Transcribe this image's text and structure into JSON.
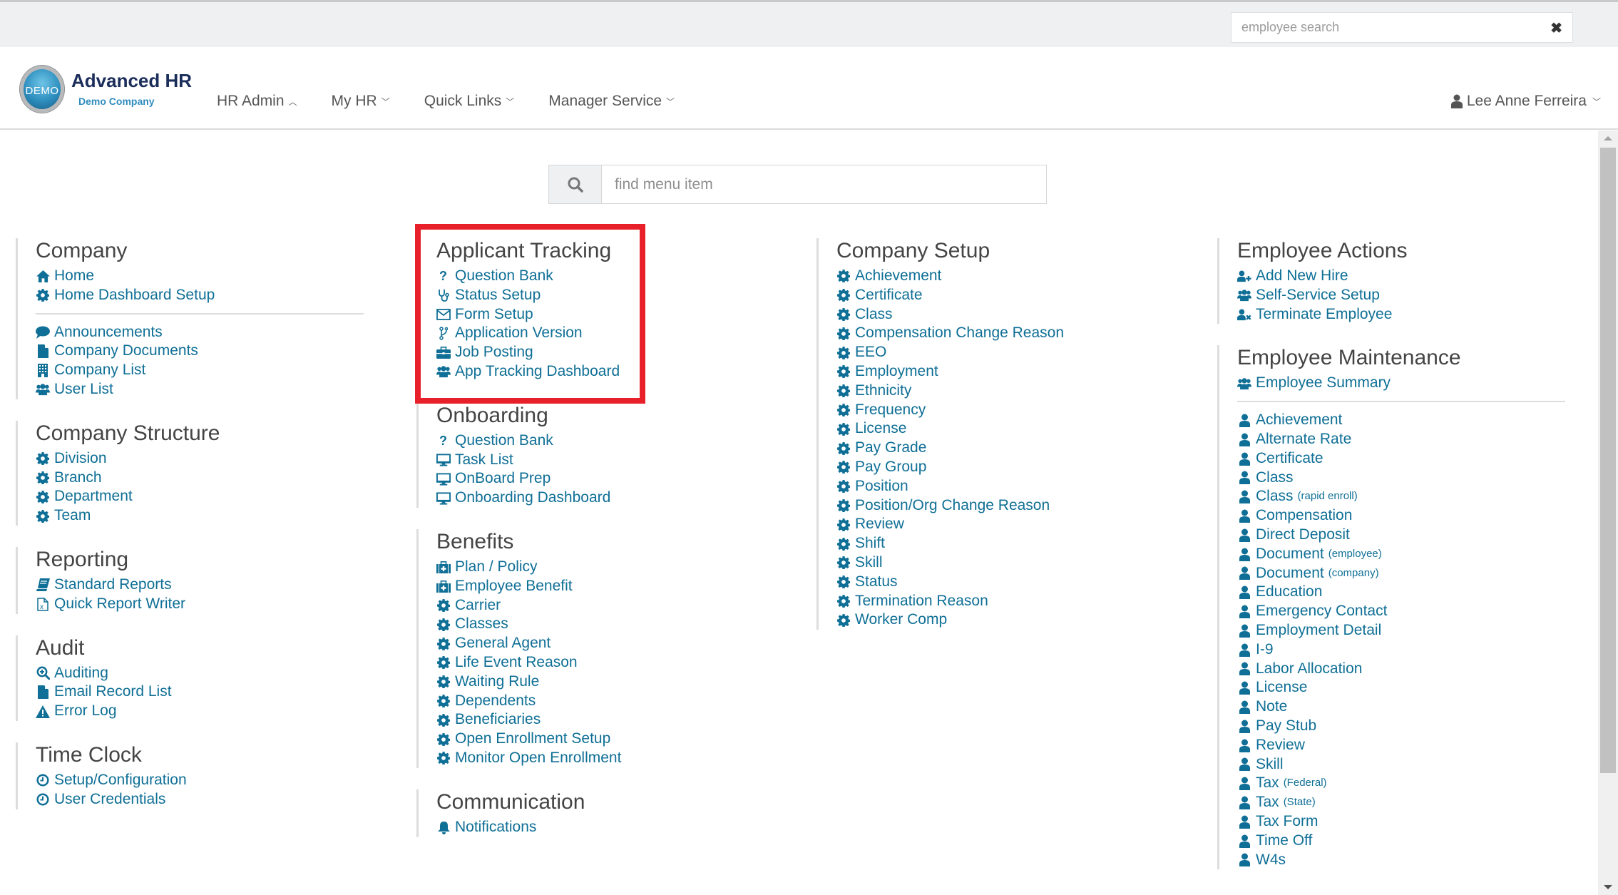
{
  "topbar": {
    "employee_search_placeholder": "employee search",
    "clear_icon": "times-icon"
  },
  "header": {
    "logo_badge": "DEMO",
    "app_title": "Advanced HR",
    "company": "Demo Company",
    "nav": [
      {
        "label": "HR Admin",
        "state": "expanded"
      },
      {
        "label": "My HR",
        "state": "collapsed"
      },
      {
        "label": "Quick Links",
        "state": "collapsed"
      },
      {
        "label": "Manager Service",
        "state": "collapsed"
      }
    ],
    "user": {
      "name": "Lee Anne Ferreira",
      "icon": "user-icon"
    }
  },
  "find_menu": {
    "placeholder": "find menu item",
    "icon": "search-icon"
  },
  "colors": {
    "link": "#0f6f96",
    "heading": "#444444",
    "highlight": "#e8202a"
  },
  "columns": [
    {
      "sections": [
        {
          "title": "Company",
          "groups": [
            [
              {
                "label": "Home",
                "icon": "home"
              },
              {
                "label": "Home Dashboard Setup",
                "icon": "cog"
              }
            ],
            [
              {
                "label": "Announcements",
                "icon": "comment"
              },
              {
                "label": "Company Documents",
                "icon": "file"
              },
              {
                "label": "Company List",
                "icon": "building"
              },
              {
                "label": "User List",
                "icon": "users"
              }
            ]
          ]
        },
        {
          "title": "Company Structure",
          "groups": [
            [
              {
                "label": "Division",
                "icon": "cog"
              },
              {
                "label": "Branch",
                "icon": "cog"
              },
              {
                "label": "Department",
                "icon": "cog"
              },
              {
                "label": "Team",
                "icon": "cog"
              }
            ]
          ]
        },
        {
          "title": "Reporting",
          "groups": [
            [
              {
                "label": "Standard Reports",
                "icon": "book"
              },
              {
                "label": "Quick Report Writer",
                "icon": "file-excel"
              }
            ]
          ]
        },
        {
          "title": "Audit",
          "groups": [
            [
              {
                "label": "Auditing",
                "icon": "search-plus"
              },
              {
                "label": "Email Record List",
                "icon": "file"
              },
              {
                "label": "Error Log",
                "icon": "warning"
              }
            ]
          ]
        },
        {
          "title": "Time Clock",
          "groups": [
            [
              {
                "label": "Setup/Configuration",
                "icon": "clock"
              },
              {
                "label": "User Credentials",
                "icon": "clock"
              }
            ]
          ]
        }
      ]
    },
    {
      "sections": [
        {
          "title": "Applicant Tracking",
          "highlighted": true,
          "groups": [
            [
              {
                "label": "Question Bank",
                "icon": "question"
              },
              {
                "label": "Status Setup",
                "icon": "stethoscope"
              },
              {
                "label": "Form Setup",
                "icon": "envelope"
              },
              {
                "label": "Application Version",
                "icon": "code-fork"
              },
              {
                "label": "Job Posting",
                "icon": "briefcase"
              },
              {
                "label": "App Tracking Dashboard",
                "icon": "users"
              }
            ]
          ]
        },
        {
          "title": "Onboarding",
          "groups": [
            [
              {
                "label": "Question Bank",
                "icon": "question"
              },
              {
                "label": "Task List",
                "icon": "desktop"
              },
              {
                "label": "OnBoard Prep",
                "icon": "desktop"
              },
              {
                "label": "Onboarding Dashboard",
                "icon": "desktop"
              }
            ]
          ]
        },
        {
          "title": "Benefits",
          "groups": [
            [
              {
                "label": "Plan / Policy",
                "icon": "medkit"
              },
              {
                "label": "Employee Benefit",
                "icon": "medkit"
              },
              {
                "label": "Carrier",
                "icon": "cog"
              },
              {
                "label": "Classes",
                "icon": "cog"
              },
              {
                "label": "General Agent",
                "icon": "cog"
              },
              {
                "label": "Life Event Reason",
                "icon": "cog"
              },
              {
                "label": "Waiting Rule",
                "icon": "cog"
              },
              {
                "label": "Dependents",
                "icon": "cog"
              },
              {
                "label": "Beneficiaries",
                "icon": "cog"
              },
              {
                "label": "Open Enrollment Setup",
                "icon": "cog"
              },
              {
                "label": "Monitor Open Enrollment",
                "icon": "cog"
              }
            ]
          ]
        },
        {
          "title": "Communication",
          "groups": [
            [
              {
                "label": "Notifications",
                "icon": "bell"
              }
            ]
          ]
        }
      ]
    },
    {
      "sections": [
        {
          "title": "Company Setup",
          "groups": [
            [
              {
                "label": "Achievement",
                "icon": "cog"
              },
              {
                "label": "Certificate",
                "icon": "cog"
              },
              {
                "label": "Class",
                "icon": "cog"
              },
              {
                "label": "Compensation Change Reason",
                "icon": "cog"
              },
              {
                "label": "EEO",
                "icon": "cog"
              },
              {
                "label": "Employment",
                "icon": "cog"
              },
              {
                "label": "Ethnicity",
                "icon": "cog"
              },
              {
                "label": "Frequency",
                "icon": "cog"
              },
              {
                "label": "License",
                "icon": "cog"
              },
              {
                "label": "Pay Grade",
                "icon": "cog"
              },
              {
                "label": "Pay Group",
                "icon": "cog"
              },
              {
                "label": "Position",
                "icon": "cog"
              },
              {
                "label": "Position/Org Change Reason",
                "icon": "cog"
              },
              {
                "label": "Review",
                "icon": "cog"
              },
              {
                "label": "Shift",
                "icon": "cog"
              },
              {
                "label": "Skill",
                "icon": "cog"
              },
              {
                "label": "Status",
                "icon": "cog"
              },
              {
                "label": "Termination Reason",
                "icon": "cog"
              },
              {
                "label": "Worker Comp",
                "icon": "cog"
              }
            ]
          ]
        }
      ]
    },
    {
      "sections": [
        {
          "title": "Employee Actions",
          "groups": [
            [
              {
                "label": "Add New Hire",
                "icon": "user-plus"
              },
              {
                "label": "Self-Service Setup",
                "icon": "users"
              },
              {
                "label": "Terminate Employee",
                "icon": "user-times"
              }
            ]
          ]
        },
        {
          "title": "Employee Maintenance",
          "groups": [
            [
              {
                "label": "Employee Summary",
                "icon": "users"
              }
            ],
            [
              {
                "label": "Achievement",
                "icon": "user"
              },
              {
                "label": "Alternate Rate",
                "icon": "user"
              },
              {
                "label": "Certificate",
                "icon": "user"
              },
              {
                "label": "Class",
                "icon": "user"
              },
              {
                "label": "Class",
                "suffix": "(rapid enroll)",
                "icon": "user"
              },
              {
                "label": "Compensation",
                "icon": "user"
              },
              {
                "label": "Direct Deposit",
                "icon": "user"
              },
              {
                "label": "Document",
                "suffix": "(employee)",
                "icon": "user"
              },
              {
                "label": "Document",
                "suffix": "(company)",
                "icon": "user"
              },
              {
                "label": "Education",
                "icon": "user"
              },
              {
                "label": "Emergency Contact",
                "icon": "user"
              },
              {
                "label": "Employment Detail",
                "icon": "user"
              },
              {
                "label": "I-9",
                "icon": "user"
              },
              {
                "label": "Labor Allocation",
                "icon": "user"
              },
              {
                "label": "License",
                "icon": "user"
              },
              {
                "label": "Note",
                "icon": "user"
              },
              {
                "label": "Pay Stub",
                "icon": "user"
              },
              {
                "label": "Review",
                "icon": "user"
              },
              {
                "label": "Skill",
                "icon": "user"
              },
              {
                "label": "Tax",
                "suffix": "(Federal)",
                "icon": "user"
              },
              {
                "label": "Tax",
                "suffix": "(State)",
                "icon": "user"
              },
              {
                "label": "Tax Form",
                "icon": "user"
              },
              {
                "label": "Time Off",
                "icon": "user"
              },
              {
                "label": "W4s",
                "icon": "user"
              }
            ]
          ]
        }
      ]
    }
  ]
}
